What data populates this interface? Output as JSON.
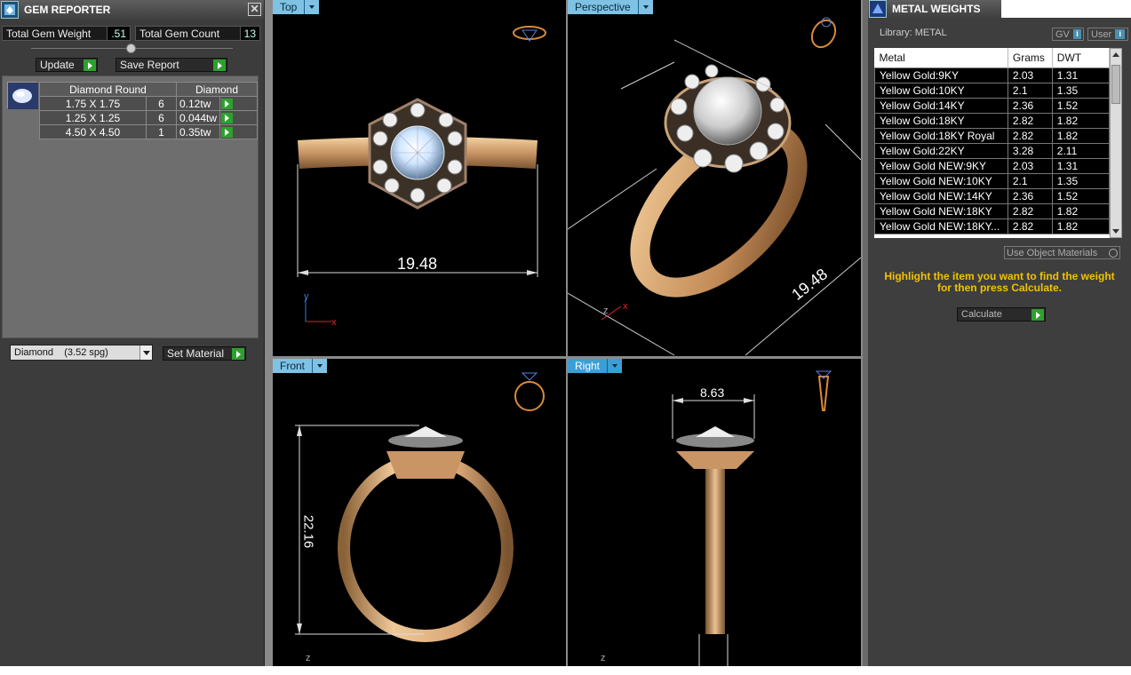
{
  "gem_reporter": {
    "title": "GEM REPORTER",
    "close_glyph": "✕",
    "total_weight_label": "Total Gem Weight",
    "total_weight_value": ".51",
    "total_count_label": "Total Gem Count",
    "total_count_value": "13",
    "update_label": "Update",
    "save_label": "Save Report",
    "table": {
      "headers": [
        "Diamond Round",
        "Diamond"
      ],
      "rows": [
        {
          "size": "1.75 X 1.75",
          "count": "6",
          "weight": "0.12tw"
        },
        {
          "size": "1.25 X 1.25",
          "count": "6",
          "weight": "0.044tw"
        },
        {
          "size": "4.50 X 4.50",
          "count": "1",
          "weight": "0.35tw"
        }
      ]
    },
    "material_select": "Diamond    (3.52 spg)",
    "set_material_label": "Set Material"
  },
  "viewports": {
    "top": {
      "label": "Top",
      "dimension": "19.48",
      "axis_y": "y",
      "axis_x": "x"
    },
    "perspective": {
      "label": "Perspective",
      "dimension": "19.48",
      "axis_z": "z",
      "axis_x": "x"
    },
    "front": {
      "label": "Front",
      "dimension": "22.16",
      "axis_z": "z"
    },
    "right": {
      "label": "Right",
      "dimension": "8.63",
      "axis_z": "z"
    }
  },
  "metal_weights": {
    "title": "METAL WEIGHTS",
    "library": "Library: METAL",
    "gv_label": "GV",
    "user_label": "User",
    "headers": [
      "Metal",
      "Grams",
      "DWT"
    ],
    "rows": [
      {
        "metal": "Yellow Gold:9KY",
        "grams": "2.03",
        "dwt": "1.31"
      },
      {
        "metal": "Yellow Gold:10KY",
        "grams": "2.1",
        "dwt": "1.35"
      },
      {
        "metal": "Yellow Gold:14KY",
        "grams": "2.36",
        "dwt": "1.52"
      },
      {
        "metal": "Yellow Gold:18KY",
        "grams": "2.82",
        "dwt": "1.82"
      },
      {
        "metal": "Yellow Gold:18KY Royal",
        "grams": "2.82",
        "dwt": "1.82"
      },
      {
        "metal": "Yellow Gold:22KY",
        "grams": "3.28",
        "dwt": "2.11"
      },
      {
        "metal": "Yellow Gold NEW:9KY",
        "grams": "2.03",
        "dwt": "1.31"
      },
      {
        "metal": "Yellow Gold NEW:10KY",
        "grams": "2.1",
        "dwt": "1.35"
      },
      {
        "metal": "Yellow Gold NEW:14KY",
        "grams": "2.36",
        "dwt": "1.52"
      },
      {
        "metal": "Yellow Gold NEW:18KY",
        "grams": "2.82",
        "dwt": "1.82"
      },
      {
        "metal": "Yellow Gold NEW:18KY...",
        "grams": "2.82",
        "dwt": "1.82"
      }
    ],
    "use_object_materials": "Use Object Materials",
    "hint": "Highlight the item you want to find the weight for then press Calculate.",
    "calculate_label": "Calculate"
  }
}
